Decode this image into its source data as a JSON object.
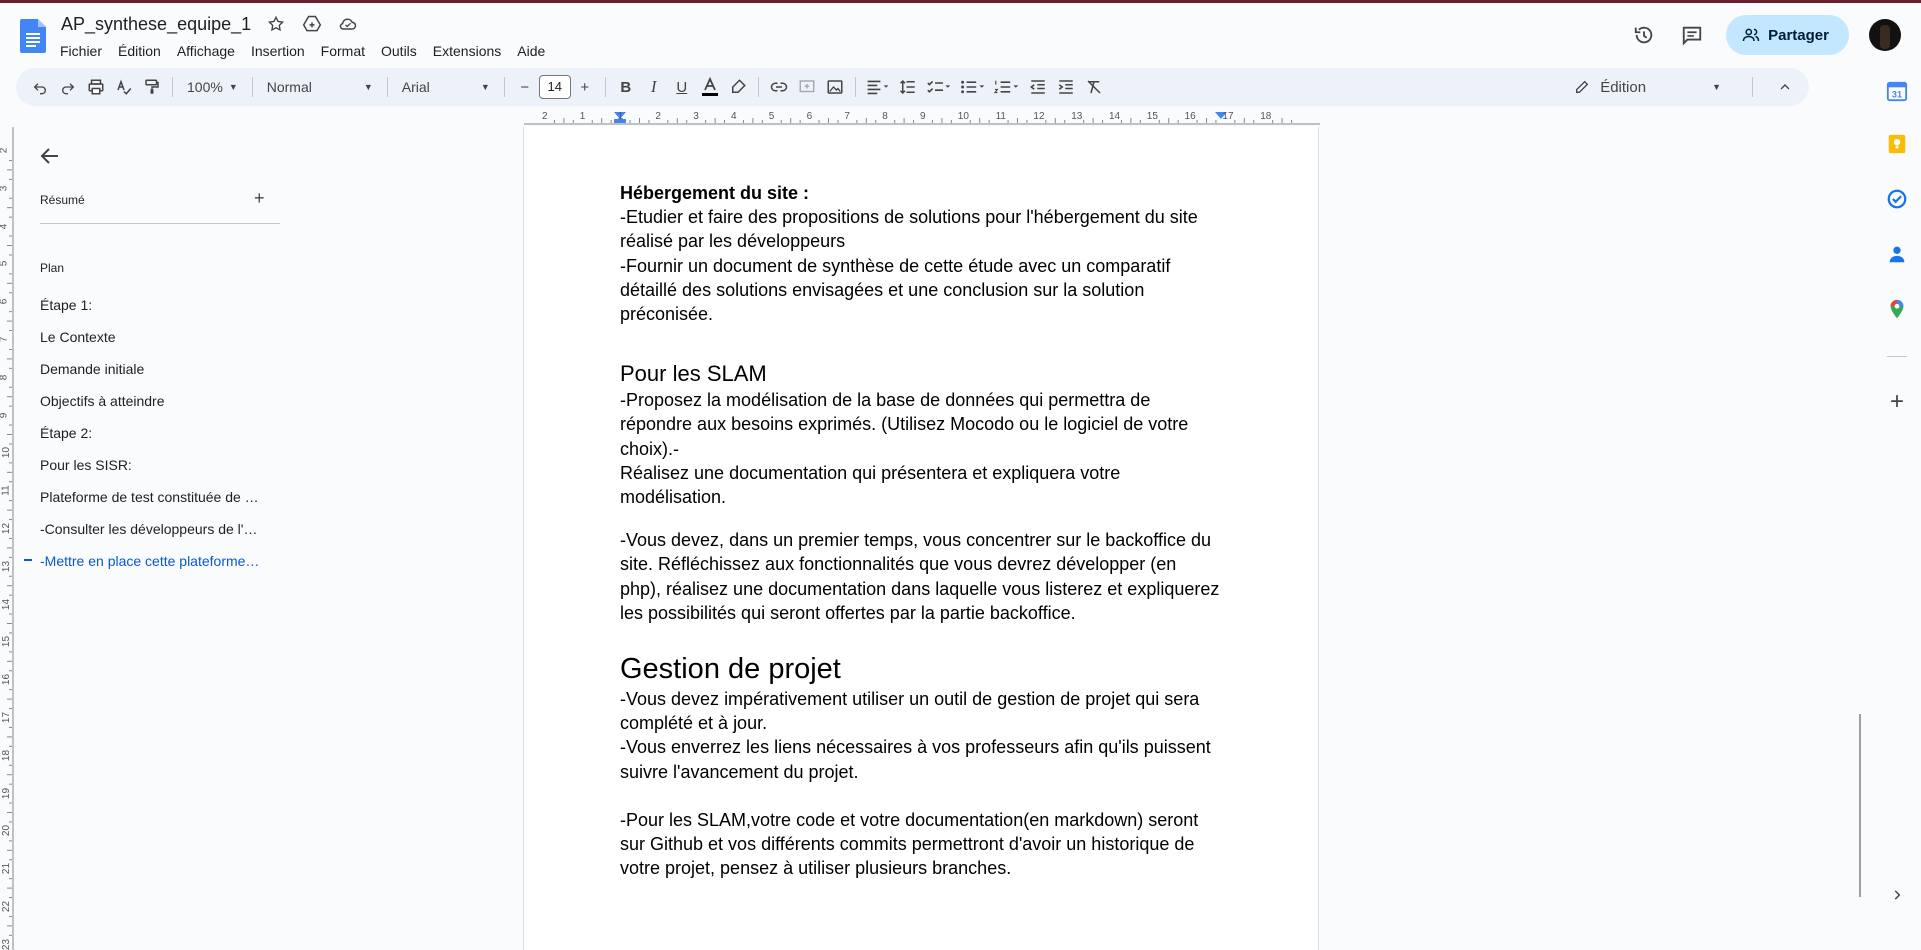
{
  "header": {
    "doc_title": "AP_synthese_equipe_1",
    "menu": [
      "Fichier",
      "Édition",
      "Affichage",
      "Insertion",
      "Format",
      "Outils",
      "Extensions",
      "Aide"
    ],
    "share_label": "Partager"
  },
  "toolbar": {
    "zoom": "100%",
    "style": "Normal",
    "font": "Arial",
    "font_size": "14",
    "mode": "Édition"
  },
  "outline": {
    "summary_label": "Résumé",
    "plan_label": "Plan",
    "items": [
      "Étape 1:",
      "Le Contexte",
      "Demande initiale",
      "Objectifs à atteindre",
      "Étape 2:",
      "Pour les SISR:",
      "Plateforme de test constituée de …",
      "-Consulter les développeurs de l'…",
      "-Mettre en place cette plateforme…"
    ]
  },
  "ruler": {
    "h_numbers": [
      "2",
      "1",
      "1",
      "2",
      "3",
      "4",
      "5",
      "6",
      "7",
      "8",
      "9",
      "10",
      "11",
      "12",
      "13",
      "14",
      "15",
      "16",
      "17",
      "18"
    ],
    "v_numbers": [
      "2",
      "3",
      "4",
      "5",
      "6",
      "7",
      "8",
      "9",
      "10",
      "11",
      "12",
      "13",
      "14",
      "15",
      "16",
      "17",
      "18",
      "19",
      "20",
      "21",
      "22",
      "23"
    ]
  },
  "document": {
    "hosting_heading": "Hébergement du site :",
    "hosting_l1": "-Etudier et faire des propositions de solutions pour l'hébergement du site",
    "hosting_l2": "réalisé par les développeurs",
    "hosting_l3": "-Fournir un document de synthèse de cette étude avec un comparatif",
    "hosting_l4": "détaillé des solutions envisagées et une conclusion sur la solution",
    "hosting_l5": "préconisée.",
    "slam_heading": "Pour les SLAM",
    "slam_l1": "-Proposez la modélisation de la base de données qui permettra de",
    "slam_l2": "répondre aux besoins exprimés.  (Utilisez Mocodo ou le logiciel de votre",
    "slam_l3": "choix).-",
    "slam_l4": "Réalisez une documentation qui présentera et expliquera votre",
    "slam_l5": "modélisation.",
    "slam_l6": "-Vous devez, dans un premier temps, vous concentrer sur le backoffice du",
    "slam_l7": "site. Réfléchissez aux fonctionnalités que vous devrez développer (en",
    "slam_l8": "php), réalisez une documentation dans laquelle vous listerez et expliquerez",
    "slam_l9": "les possibilités qui seront offertes par la partie backoffice.",
    "pm_heading": "Gestion de projet",
    "pm_l1": "-Vous devez impérativement utiliser un outil de gestion de projet qui sera",
    "pm_l2": "complété et à jour.",
    "pm_l3": "-Vous enverrez les liens nécessaires à vos professeurs afin qu'ils puissent",
    "pm_l4": "suivre l'avancement du projet.",
    "pm_l5": "-Pour les SLAM,votre code et votre documentation(en markdown) seront",
    "pm_l6": "sur Github et vos différents commits permettront d'avoir un historique de",
    "pm_l7": "votre projet, pensez à utiliser plusieurs branches."
  },
  "side_panel_icons": [
    "calendar-icon",
    "keep-icon",
    "tasks-icon",
    "contacts-icon",
    "maps-icon",
    "add-icon",
    "expand-icon"
  ],
  "colors": {
    "accent": "#0b57d0",
    "share_bg": "#c2e7ff",
    "toolbar_bg": "#edf2fa"
  }
}
